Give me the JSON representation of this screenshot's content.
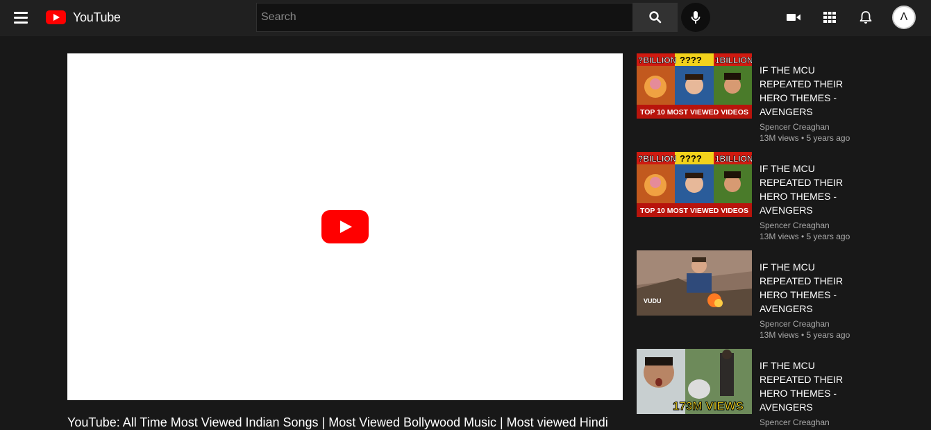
{
  "header": {
    "logo_text": "YouTube",
    "search_placeholder": "Search",
    "avatar_letter": "Λ"
  },
  "player": {
    "title": "YouTube: All Time Most Viewed Indian Songs | Most Viewed Bollywood Music | Most viewed Hindi"
  },
  "recommendations": [
    {
      "title": "IF THE MCU REPEATED THEIR HERO THEMES - AVENGERS",
      "channel": "Spencer Creaghan",
      "meta": "13M views • 5 years ago",
      "thumb": {
        "style": "billion",
        "top_left": "?BILLION",
        "top_mid": "????",
        "top_right": "1BILLION",
        "bottom": "TOP 10 MOST VIEWED VIDEOS"
      }
    },
    {
      "title": "IF THE MCU REPEATED THEIR HERO THEMES - AVENGERS",
      "channel": "Spencer Creaghan",
      "meta": "13M views • 5 years ago",
      "thumb": {
        "style": "billion",
        "top_left": "?BILLION",
        "top_mid": "????",
        "top_right": "1BILLION",
        "bottom": "TOP 10 MOST VIEWED VIDEOS"
      }
    },
    {
      "title": "IF THE MCU REPEATED THEIR HERO THEMES - AVENGERS",
      "channel": "Spencer Creaghan",
      "meta": "13M views • 5 years ago",
      "thumb": {
        "style": "strange",
        "badge": "VUDU"
      }
    },
    {
      "title": "IF THE MCU REPEATED THEIR HERO THEMES - AVENGERS",
      "channel": "Spencer Creaghan",
      "meta": "",
      "thumb": {
        "style": "views",
        "badge": "173M VIEWS"
      }
    }
  ]
}
